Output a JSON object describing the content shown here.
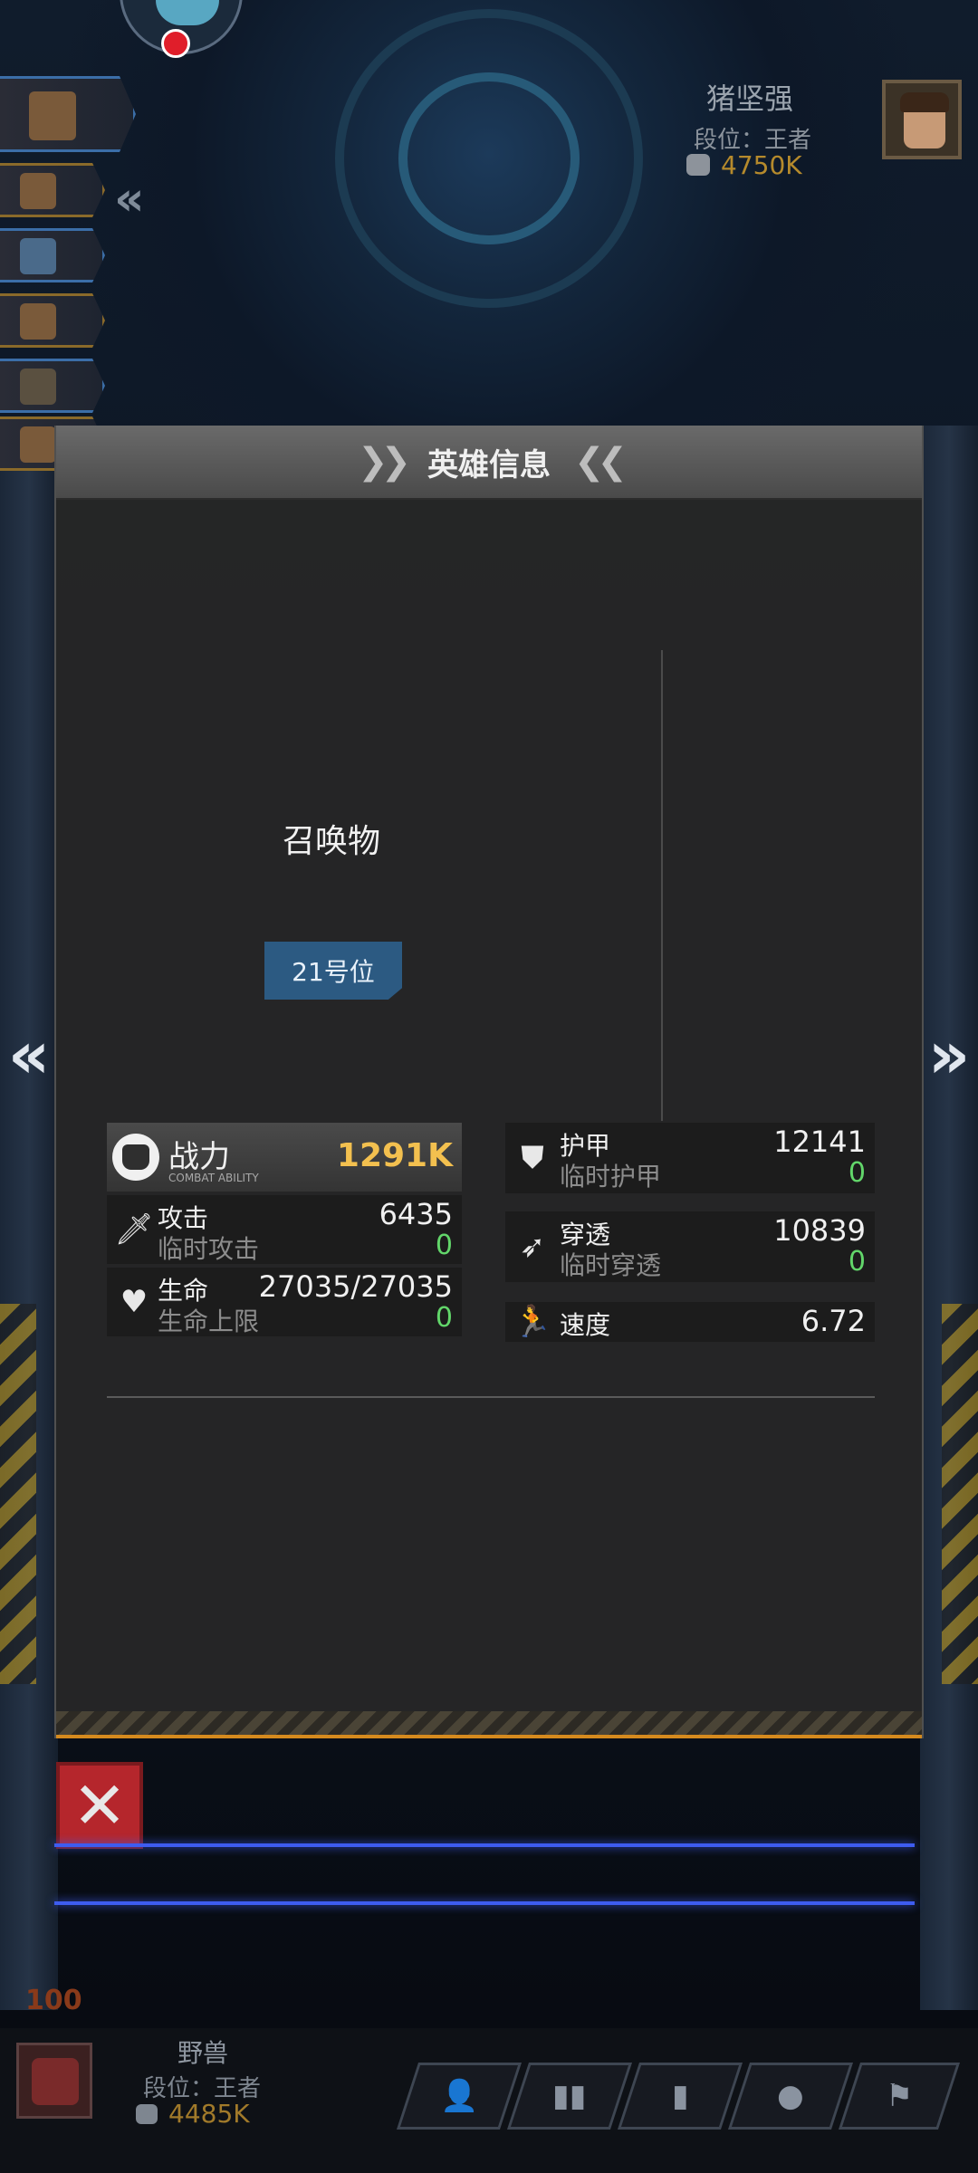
{
  "opponent": {
    "name": "猪坚强",
    "rank": "段位：王者",
    "power": "4750K"
  },
  "dialog": {
    "title": "英雄信息",
    "summon_label": "召唤物",
    "slot_badge": "21号位"
  },
  "stats": {
    "combat": {
      "label": "战力",
      "label_en": "COMBAT ABILITY",
      "value": "1291K"
    },
    "attack": {
      "label": "攻击",
      "sub_label": "临时攻击",
      "value": "6435",
      "temp": "0"
    },
    "life": {
      "label": "生命",
      "sub_label": "生命上限",
      "value": "27035/27035",
      "temp": "0"
    },
    "armor": {
      "label": "护甲",
      "sub_label": "临时护甲",
      "value": "12141",
      "temp": "0"
    },
    "penetration": {
      "label": "穿透",
      "sub_label": "临时穿透",
      "value": "10839",
      "temp": "0"
    },
    "speed": {
      "label": "速度",
      "value": "6.72"
    }
  },
  "player": {
    "name": "野兽",
    "rank": "段位：王者",
    "power": "4485K",
    "level": "100"
  },
  "bottom_nav": [
    {
      "icon": "profile-icon"
    },
    {
      "icon": "stats-icon"
    },
    {
      "icon": "bottle-icon"
    },
    {
      "icon": "emoji-icon"
    },
    {
      "icon": "flag-icon"
    }
  ],
  "colors": {
    "combat_value": "#f3c04f",
    "temp_value": "#62d66a",
    "slot_badge": "#2c5a82",
    "close_button": "#b5262c",
    "footer_accent": "#d58a1e"
  }
}
